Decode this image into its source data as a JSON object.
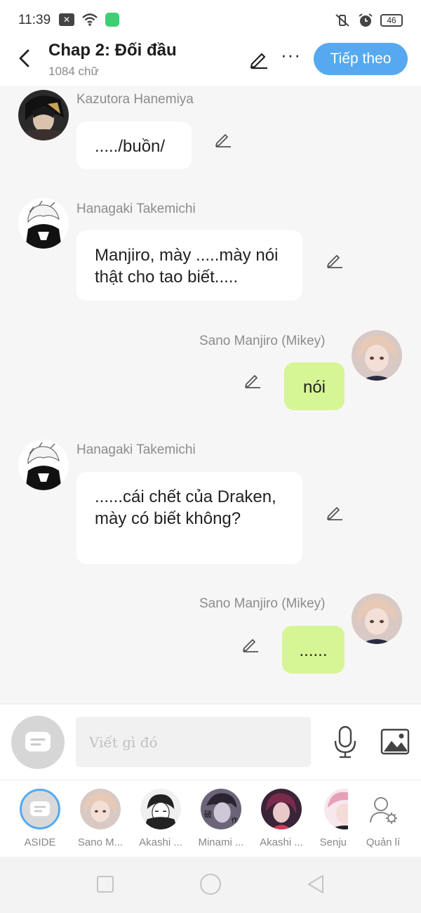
{
  "status_bar": {
    "time": "11:39",
    "battery": "46",
    "icons": [
      "x-box-icon",
      "wifi-icon",
      "app-green-icon",
      "mute-vibrate-icon",
      "alarm-icon",
      "battery-icon"
    ]
  },
  "header": {
    "title": "Chap 2: Đối đầu",
    "subtitle": "1084 chữ",
    "next_label": "Tiếp theo",
    "more_label": "···",
    "accent": "#56a9f0"
  },
  "messages": [
    {
      "sender": "Kazutora Hanemiya",
      "text": "...../buồn/",
      "side": "left",
      "avatar": "kazutora-avatar"
    },
    {
      "sender": "Hanagaki Takemichi",
      "text": "Manjiro, mày .....mày nói thật cho tao biết.....",
      "side": "left",
      "avatar": "takemichi-avatar"
    },
    {
      "sender": "Sano Manjiro (Mikey)",
      "text": "nói",
      "side": "right",
      "avatar": "mikey-avatar"
    },
    {
      "sender": "Hanagaki Takemichi",
      "text": "......cái chết của Draken, mày có biết không?",
      "side": "left",
      "avatar": "takemichi-avatar"
    },
    {
      "sender": "Sano Manjiro (Mikey)",
      "text": "......",
      "side": "right",
      "avatar": "mikey-avatar"
    }
  ],
  "composer": {
    "placeholder": "Viết gì đó"
  },
  "characters": [
    {
      "label": "ASIDE"
    },
    {
      "label": "Sano M..."
    },
    {
      "label": "Akashi ..."
    },
    {
      "label": "Minami ..."
    },
    {
      "label": "Akashi ..."
    },
    {
      "label": "Senju"
    },
    {
      "label": "Quản lí"
    }
  ],
  "colors": {
    "my_bubble": "#d6f594",
    "other_bubble": "#ffffff",
    "background": "#f6f6f6"
  }
}
